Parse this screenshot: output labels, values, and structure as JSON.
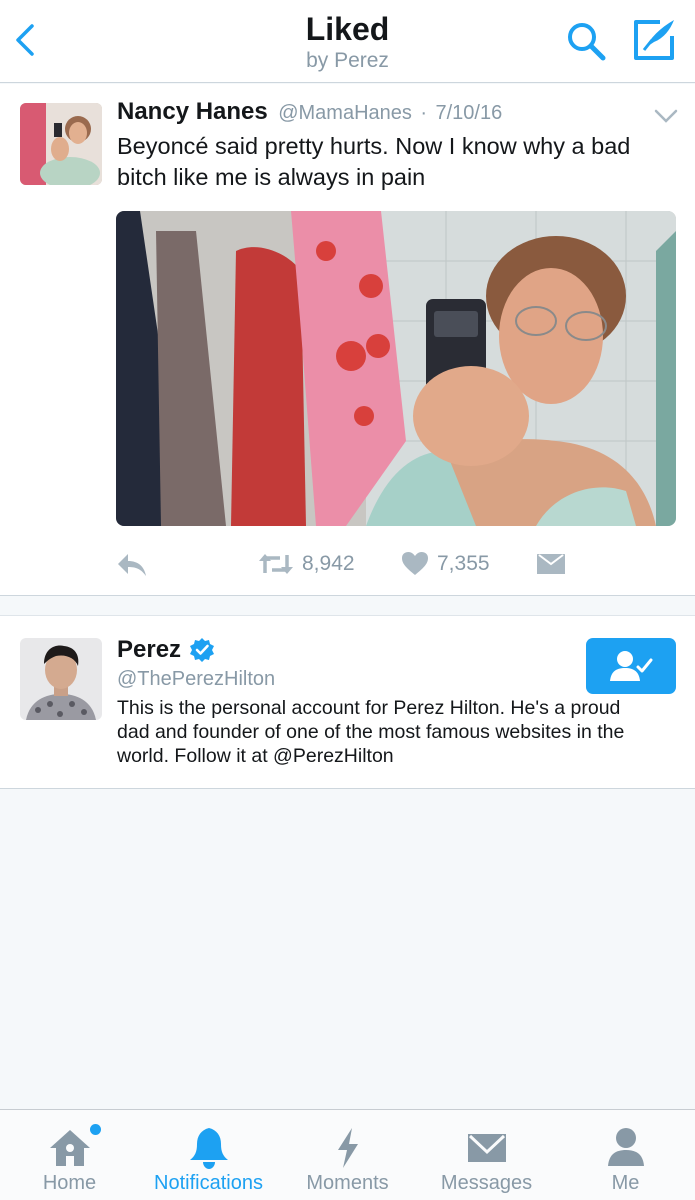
{
  "header": {
    "title": "Liked",
    "subtitle": "by Perez"
  },
  "tweet": {
    "name": "Nancy Hanes",
    "handle": "@MamaHanes",
    "separator": "·",
    "date": "7/10/16",
    "text": "Beyoncé said pretty hurts. Now I know why a bad bitch like me is always in pain",
    "retweet_count": "8,942",
    "like_count": "7,355"
  },
  "user": {
    "name": "Perez",
    "handle": "@ThePerezHilton",
    "bio": "This is the personal account for Perez Hilton. He's a proud dad and founder of one of the most famous websites in the world. Follow it at @PerezHilton"
  },
  "tabs": [
    {
      "label": "Home",
      "icon": "home-icon",
      "active": false,
      "badge": true
    },
    {
      "label": "Notifications",
      "icon": "bell-icon",
      "active": true
    },
    {
      "label": "Moments",
      "icon": "lightning-icon",
      "active": false
    },
    {
      "label": "Messages",
      "icon": "envelope-icon",
      "active": false
    },
    {
      "label": "Me",
      "icon": "person-icon",
      "active": false
    }
  ],
  "colors": {
    "accent": "#1da1f2",
    "muted": "#8899a6",
    "background": "#f5f8fa"
  }
}
